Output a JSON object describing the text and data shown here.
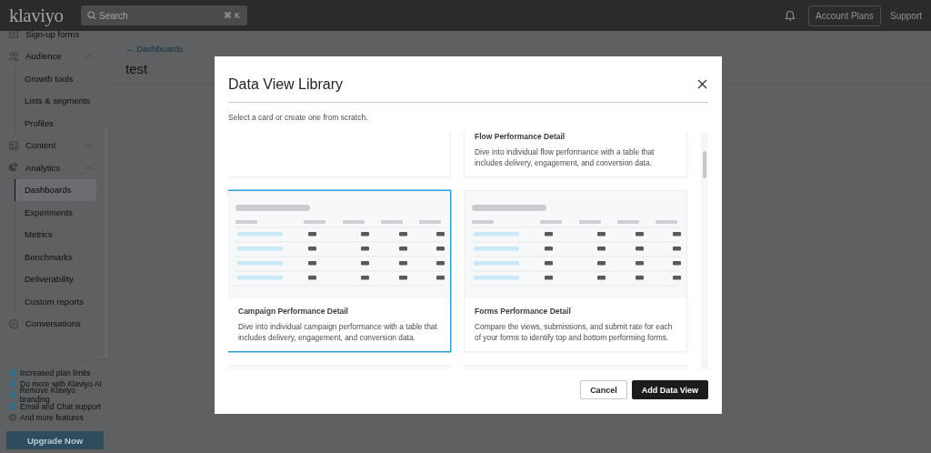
{
  "topbar": {
    "logo": "klaviyo",
    "search": {
      "placeholder": "Search",
      "shortcut": "⌘ K"
    },
    "account_button": "Account Plans",
    "support_link": "Support"
  },
  "sidebar": {
    "items": [
      {
        "label": "Sign-up forms"
      },
      {
        "label": "Audience",
        "expanded": true,
        "children": [
          {
            "label": "Growth tools",
            "selected": false
          },
          {
            "label": "Lists & segments",
            "selected": false
          },
          {
            "label": "Profiles",
            "selected": false
          }
        ]
      },
      {
        "label": "Content",
        "expanded": false
      },
      {
        "label": "Analytics",
        "expanded": true,
        "children": [
          {
            "label": "Dashboards",
            "selected": true
          },
          {
            "label": "Experiments",
            "selected": false
          },
          {
            "label": "Metrics",
            "selected": false
          },
          {
            "label": "Benchmarks",
            "selected": false
          },
          {
            "label": "Deliverability",
            "selected": false
          },
          {
            "label": "Custom reports",
            "selected": false
          }
        ]
      },
      {
        "label": "Conversations"
      }
    ],
    "upgrade_features": [
      {
        "label": "Increased plan limits",
        "color": "#2f6e8c"
      },
      {
        "label": "Do more with Klaviyo AI",
        "color": "#2f6e8c"
      },
      {
        "label": "Remove Klaviyo branding",
        "color": "#2f6e8c"
      },
      {
        "label": "Email and Chat support",
        "color": "#2f6e8c"
      },
      {
        "label": "And more features",
        "color": "#454648"
      }
    ],
    "upgrade_button": "Upgrade Now"
  },
  "page": {
    "breadcrumb": "← Dashboards",
    "title": "test"
  },
  "modal": {
    "title": "Data View Library",
    "subtitle": "Select a card or create one from scratch.",
    "cards": [
      {
        "selected": false
      },
      {
        "title": "Flow Performance Detail",
        "description": "Dive into individual flow performance with a table that includes delivery, engagement, and conversion data.",
        "selected": false
      },
      {
        "title": "Campaign Performance Detail",
        "description": "Dive into individual campaign performance with a table that includes delivery, engagement, and conversion data.",
        "selected": true
      },
      {
        "title": "Forms Performance Detail",
        "description": "Compare the views, submissions, and submit rate for each of your forms to identify top and bottom performing forms.",
        "selected": false
      },
      {
        "selected": false
      },
      {
        "selected": false
      }
    ],
    "buttons": [
      {
        "label": "Cancel",
        "kind": "secondary"
      },
      {
        "label": "Add Data View",
        "kind": "primary"
      }
    ]
  }
}
